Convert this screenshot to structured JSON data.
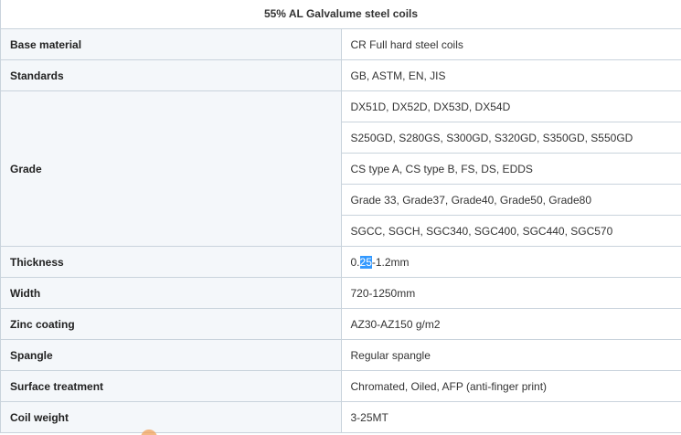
{
  "table": {
    "title": "55% AL Galvalume steel coils",
    "rows": [
      {
        "label": "Base material",
        "value": "CR Full hard steel coils"
      },
      {
        "label": "Standards",
        "value": "GB, ASTM, EN, JIS"
      },
      {
        "label": "Grade",
        "values": [
          "DX51D, DX52D, DX53D, DX54D",
          "S250GD, S280GS, S300GD, S320GD, S350GD, S550GD",
          "CS type A, CS type B, FS, DS, EDDS",
          "Grade 33, Grade37, Grade40, Grade50, Grade80",
          "SGCC, SGCH, SGC340, SGC400, SGC440, SGC570"
        ]
      },
      {
        "label": "Thickness",
        "value_parts": {
          "before": "0.",
          "selected": "25",
          "after": "-1.2mm"
        }
      },
      {
        "label": "Width",
        "value": "720-1250mm"
      },
      {
        "label": "Zinc coating",
        "value": "AZ30-AZ150 g/m2"
      },
      {
        "label": "Spangle",
        "value": "Regular spangle"
      },
      {
        "label": "Surface treatment",
        "value": "Chromated, Oiled, AFP (anti-finger print)"
      },
      {
        "label": "Coil weight",
        "value": "3-25MT"
      }
    ]
  },
  "colors": {
    "border": "#c9d3dc",
    "label_background": "#f4f7fa",
    "selection": "#3399ff"
  }
}
